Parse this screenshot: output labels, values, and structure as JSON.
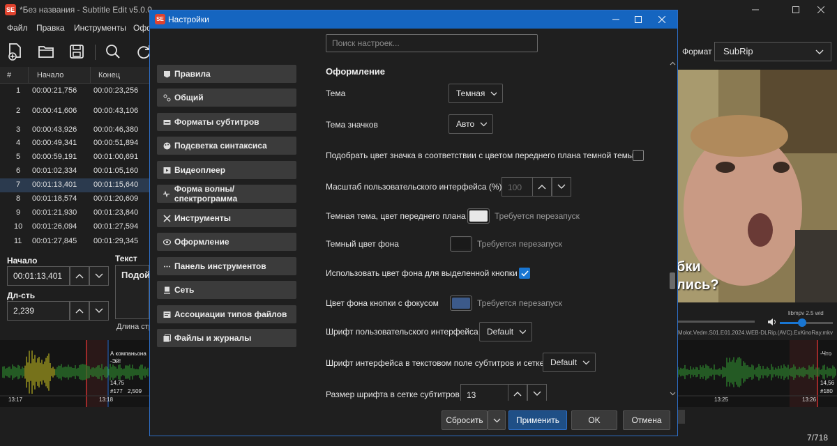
{
  "main_window": {
    "title": "*Без названия - Subtitle Edit v5.0.0",
    "app_icon_text": "SE",
    "menu": [
      "Файл",
      "Правка",
      "Инструменты",
      "Офф"
    ],
    "table": {
      "headers": [
        "#",
        "Начало",
        "Конец"
      ],
      "rows": [
        {
          "num": "1",
          "start": "00:00:21,756",
          "end": "00:00:23,256"
        },
        {
          "num": "2",
          "start": "00:00:41,606",
          "end": "00:00:43,106"
        },
        {
          "num": "3",
          "start": "00:00:43,926",
          "end": "00:00:46,380"
        },
        {
          "num": "4",
          "start": "00:00:49,341",
          "end": "00:00:51,894"
        },
        {
          "num": "5",
          "start": "00:00:59,191",
          "end": "00:01:00,691"
        },
        {
          "num": "6",
          "start": "00:01:02,334",
          "end": "00:01:05,160"
        },
        {
          "num": "7",
          "start": "00:01:13,401",
          "end": "00:01:15,640"
        },
        {
          "num": "8",
          "start": "00:01:18,574",
          "end": "00:01:20,609"
        },
        {
          "num": "9",
          "start": "00:01:21,930",
          "end": "00:01:23,840"
        },
        {
          "num": "10",
          "start": "00:01:26,094",
          "end": "00:01:27,594"
        },
        {
          "num": "11",
          "start": "00:01:27,845",
          "end": "00:01:29,345"
        }
      ]
    },
    "edit": {
      "start_label": "Начало",
      "start_value": "00:01:13,401",
      "duration_label": "Дл-сть",
      "duration_value": "2,239",
      "text_label": "Текст",
      "text_value": "Подой",
      "length_label": "Длина стр"
    },
    "format_label": "Формат",
    "format_value": "SubRip",
    "video": {
      "subtitle_line1": "бки",
      "subtitle_line2": "лись?",
      "player_label": "libmpv 2.5 wid",
      "filename": "Molot.Vedm.S01.E01.2024.WEB-DLRip.(AVC).ExKinoRay.mkv"
    },
    "waveform": {
      "left_text": "А компаньона",
      "left_text2": "-Эй!",
      "left_info": "14,75",
      "left_num": "#177",
      "left_dur": "2,509",
      "time_left1": "13:17",
      "time_left2": "13:18",
      "time_right1": "13:25",
      "time_right2": "13:26",
      "right_text": "-Что",
      "right_info": "14,56",
      "right_num": "#180"
    },
    "counter": "7/718"
  },
  "dialog": {
    "title": "Настройки",
    "icon_text": "SE",
    "nav": [
      {
        "label": "Правила",
        "icon": "rules-icon"
      },
      {
        "label": "Общий",
        "icon": "general-icon"
      },
      {
        "label": "Форматы субтитров",
        "icon": "formats-icon"
      },
      {
        "label": "Подсветка синтаксиса",
        "icon": "palette-icon"
      },
      {
        "label": "Видеоплеер",
        "icon": "video-icon"
      },
      {
        "label": "Форма волны/спектрограмма",
        "icon": "waveform-icon"
      },
      {
        "label": "Инструменты",
        "icon": "tools-icon"
      },
      {
        "label": "Оформление",
        "icon": "eye-icon"
      },
      {
        "label": "Панель инструментов",
        "icon": "dots-icon"
      },
      {
        "label": "Сеть",
        "icon": "network-icon"
      },
      {
        "label": "Ассоциации типов файлов",
        "icon": "file-assoc-icon"
      },
      {
        "label": "Файлы и журналы",
        "icon": "files-icon"
      }
    ],
    "search_placeholder": "Поиск настроек...",
    "section_title": "Оформление",
    "settings": {
      "theme_label": "Тема",
      "theme_value": "Темная",
      "icon_theme_label": "Тема значков",
      "icon_theme_value": "Авто",
      "match_icon_label": "Подобрать цвет значка в соответствии с цветом переднего плана темной темы",
      "match_icon_checked": false,
      "ui_scale_label": "Масштаб пользовательского интерфейса (%)",
      "ui_scale_value": "100",
      "dark_fg_label": "Темная тема, цвет переднего плана",
      "dark_fg_color": "#e8e8e8",
      "restart_hint": "Требуется перезапуск",
      "dark_bg_label": "Темный цвет фона",
      "dark_bg_color": "#1a1a1a",
      "use_bg_selected_label": "Использовать цвет фона для выделенной кнопки",
      "use_bg_selected_checked": true,
      "focus_bg_label": "Цвет фона кнопки с фокусом",
      "focus_bg_color": "#3c5a8a",
      "ui_font_label": "Шрифт пользовательского интерфейса",
      "ui_font_value": "Default",
      "grid_font_label": "Шрифт интерфейса в текстовом поле субтитров и сетке",
      "grid_font_value": "Default",
      "grid_font_size_label": "Размер шрифта в сетке субтитров",
      "grid_font_size_value": "13"
    },
    "buttons": {
      "reset": "Сбросить",
      "apply": "Применить",
      "ok": "OK",
      "cancel": "Отмена"
    }
  },
  "colors": {
    "accent": "#1565c0",
    "checkbox_on": "#1976d2"
  }
}
